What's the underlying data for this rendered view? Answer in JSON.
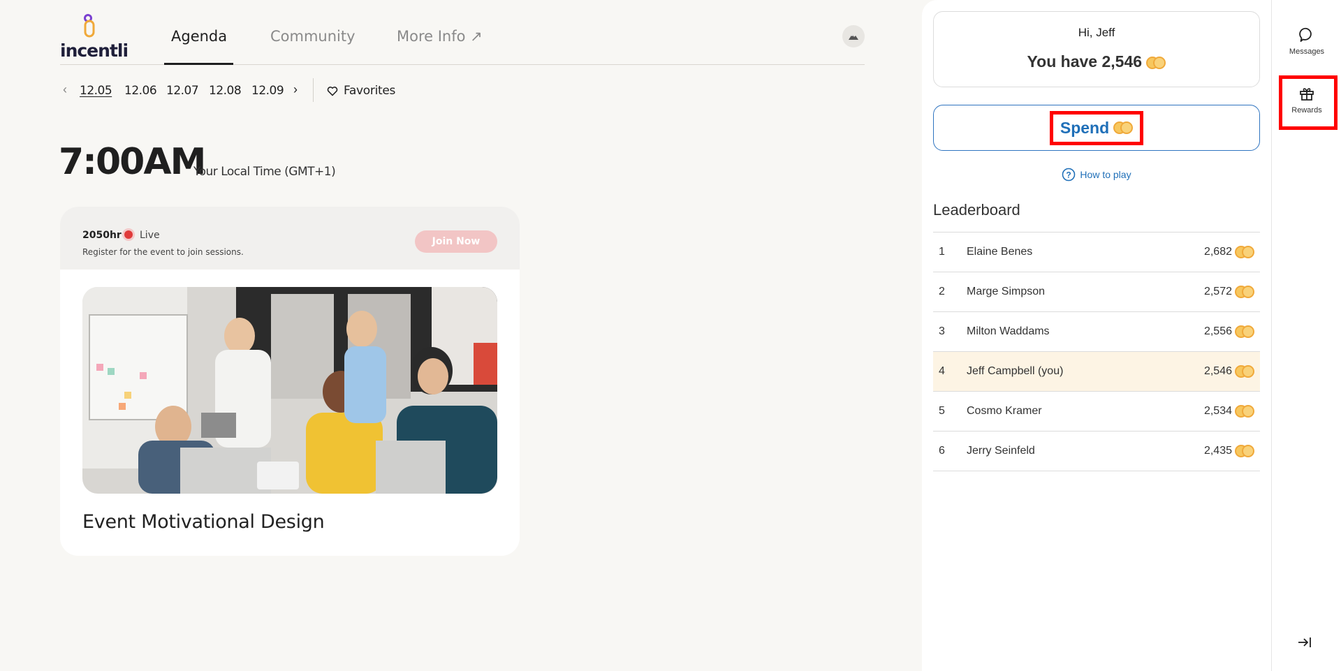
{
  "header": {
    "logo_text": "incentli",
    "tabs": [
      {
        "label": "Agenda",
        "active": true
      },
      {
        "label": "Community",
        "active": false
      },
      {
        "label": "More Info ↗",
        "active": false
      }
    ]
  },
  "datebar": {
    "dates": [
      "12.05",
      "12.06",
      "12.07",
      "12.08",
      "12.09"
    ],
    "active_date": "12.05",
    "favorites_label": "Favorites"
  },
  "time": {
    "big": "7:00AM",
    "zone": "Your Local Time (GMT+1)"
  },
  "session": {
    "time": "2050hr",
    "status": "Live",
    "note": "Register for the event to join sessions.",
    "join_label": "Join Now",
    "title": "Event Motivational Design"
  },
  "panel": {
    "greeting": "Hi, Jeff",
    "balance_text": "You have 2,546",
    "spend_label": "Spend",
    "howto_label": "How to play",
    "leaderboard_title": "Leaderboard",
    "leaderboard": [
      {
        "rank": "1",
        "name": "Elaine Benes",
        "score": "2,682",
        "me": false
      },
      {
        "rank": "2",
        "name": "Marge Simpson",
        "score": "2,572",
        "me": false
      },
      {
        "rank": "3",
        "name": "Milton Waddams",
        "score": "2,556",
        "me": false
      },
      {
        "rank": "4",
        "name": "Jeff Campbell (you)",
        "score": "2,546",
        "me": true
      },
      {
        "rank": "5",
        "name": "Cosmo Kramer",
        "score": "2,534",
        "me": false
      },
      {
        "rank": "6",
        "name": "Jerry Seinfeld",
        "score": "2,435",
        "me": false
      }
    ]
  },
  "rail": {
    "messages_label": "Messages",
    "rewards_label": "Rewards"
  },
  "colors": {
    "accent_blue": "#1f6fb8",
    "highlight_row": "#fdf4e4",
    "live_red": "#e03a3a",
    "coin": "#f7c75e",
    "annotation_red": "#ff0000"
  }
}
